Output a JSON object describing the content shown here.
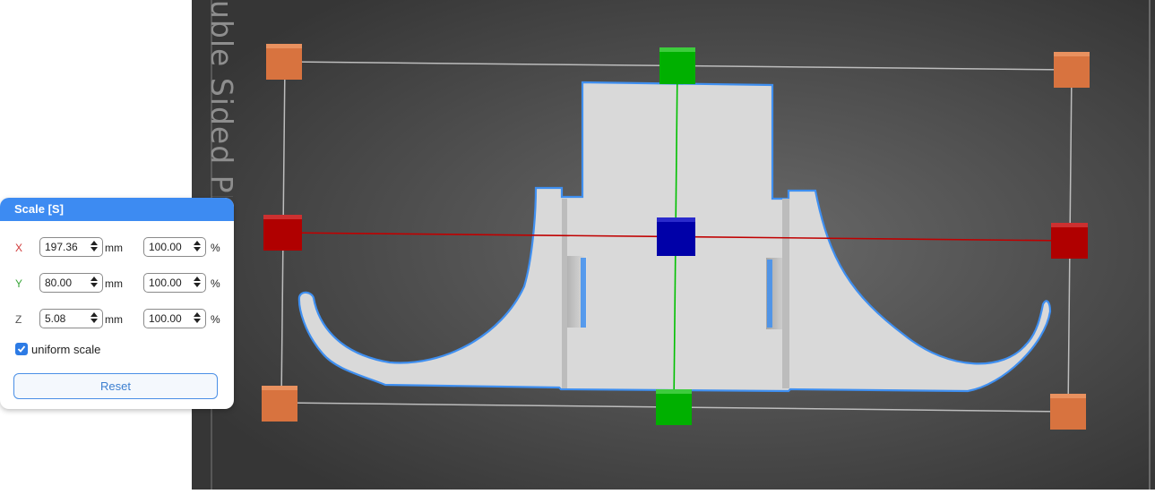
{
  "viewport": {
    "bed_label": "uble Sided PE",
    "colors": {
      "background_center": "#666666",
      "background_edge": "#3a3a3a",
      "part_fill": "#d9d9d9",
      "part_outline": "#3f8ff0",
      "x_axis": "#c00000",
      "y_axis": "#00c000",
      "center_handle": "#0000a8",
      "corner_handle": "#d8733f"
    }
  },
  "scale_panel": {
    "title": "Scale [S]",
    "rows": [
      {
        "axis": "X",
        "axis_color": "#d03a3a",
        "size": "197.36",
        "size_unit": "mm",
        "percent": "100.00",
        "percent_unit": "%"
      },
      {
        "axis": "Y",
        "axis_color": "#3aa63a",
        "size": "80.00",
        "size_unit": "mm",
        "percent": "100.00",
        "percent_unit": "%"
      },
      {
        "axis": "Z",
        "axis_color": "#555555",
        "size": "5.08",
        "size_unit": "mm",
        "percent": "100.00",
        "percent_unit": "%"
      }
    ],
    "uniform_scale": {
      "label": "uniform scale",
      "checked": true
    },
    "reset_label": "Reset"
  }
}
